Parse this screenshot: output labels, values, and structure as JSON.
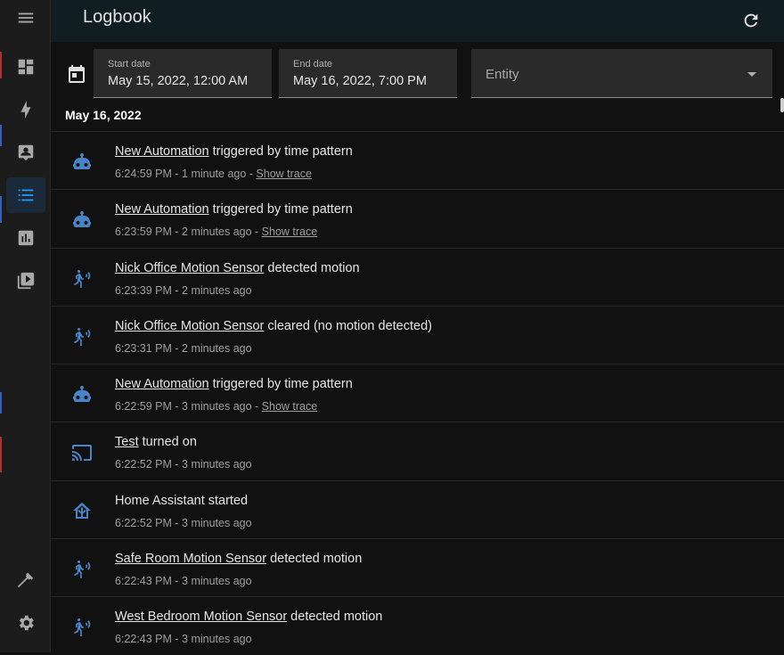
{
  "header": {
    "title": "Logbook",
    "refresh_icon": "refresh-icon"
  },
  "sidebar": {
    "items": [
      {
        "name": "menu",
        "icon": "menu-icon"
      },
      {
        "name": "overview",
        "icon": "dashboard-icon"
      },
      {
        "name": "energy",
        "icon": "lightning-icon"
      },
      {
        "name": "map",
        "icon": "account-box-icon"
      },
      {
        "name": "logbook",
        "icon": "list-icon",
        "active": true
      },
      {
        "name": "history",
        "icon": "chart-bar-icon"
      },
      {
        "name": "media",
        "icon": "play-box-icon"
      },
      {
        "name": "developer-tools",
        "icon": "hammer-icon"
      },
      {
        "name": "settings",
        "icon": "cog-icon"
      }
    ],
    "active_color": "#2b9af3"
  },
  "filters": {
    "start": {
      "label": "Start date",
      "value": "May 15, 2022, 12:00 AM"
    },
    "end": {
      "label": "End date",
      "value": "May 16, 2022, 7:00 PM"
    },
    "entity": {
      "placeholder": "Entity"
    }
  },
  "date_header": "May 16, 2022",
  "entries": [
    {
      "icon": "robot-icon",
      "entity": "New Automation",
      "message": " triggered by time pattern",
      "time": "6:24:59 PM - 1 minute ago",
      "trace": "Show trace"
    },
    {
      "icon": "robot-icon",
      "entity": "New Automation",
      "message": " triggered by time pattern",
      "time": "6:23:59 PM - 2 minutes ago",
      "trace": "Show trace"
    },
    {
      "icon": "motion-sensor-icon",
      "entity": "Nick Office Motion Sensor",
      "message": " detected motion",
      "time": "6:23:39 PM - 2 minutes ago",
      "trace": ""
    },
    {
      "icon": "motion-sensor-icon",
      "entity": "Nick Office Motion Sensor",
      "message": " cleared (no motion detected)",
      "time": "6:23:31 PM - 2 minutes ago",
      "trace": ""
    },
    {
      "icon": "robot-icon",
      "entity": "New Automation",
      "message": " triggered by time pattern",
      "time": "6:22:59 PM - 3 minutes ago",
      "trace": "Show trace"
    },
    {
      "icon": "cast-icon",
      "entity": "Test",
      "message": " turned on",
      "time": "6:22:52 PM - 3 minutes ago",
      "trace": ""
    },
    {
      "icon": "home-assistant-icon",
      "entity": "",
      "message": "Home Assistant started",
      "time": "6:22:52 PM - 3 minutes ago",
      "trace": ""
    },
    {
      "icon": "motion-sensor-icon",
      "entity": "Safe Room Motion Sensor",
      "message": " detected motion",
      "time": "6:22:43 PM - 3 minutes ago",
      "trace": ""
    },
    {
      "icon": "motion-sensor-icon",
      "entity": "West Bedroom Motion Sensor",
      "message": " detected motion",
      "time": "6:22:43 PM - 3 minutes ago",
      "trace": ""
    }
  ],
  "colors": {
    "icon": "#4a84c8",
    "background": "#111111",
    "topbar": "#101e24"
  }
}
